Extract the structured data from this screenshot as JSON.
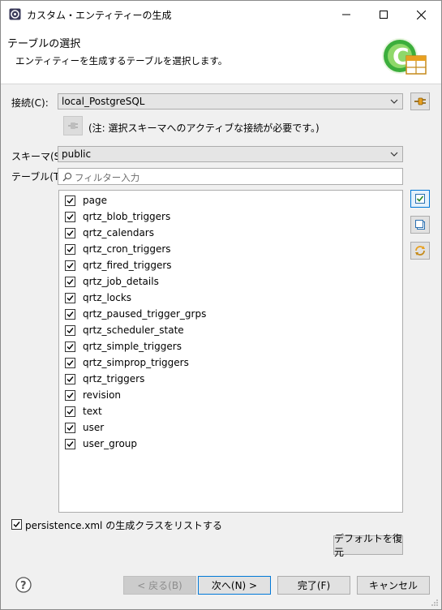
{
  "window": {
    "title": "カスタム・エンティティーの生成"
  },
  "banner": {
    "title": "テーブルの選択",
    "description": "エンティティーを生成するテーブルを選択します。"
  },
  "connection": {
    "label": "接続(C):",
    "value": "local_PostgreSQL",
    "note": "(注: 選択スキーマへのアクティブな接続が必要です。)"
  },
  "schema": {
    "label": "スキーマ(S):",
    "value": "public"
  },
  "tables": {
    "label": "テーブル(T):",
    "filter_placeholder": "フィルター入力",
    "items": [
      {
        "name": "page",
        "checked": true
      },
      {
        "name": "qrtz_blob_triggers",
        "checked": true
      },
      {
        "name": "qrtz_calendars",
        "checked": true
      },
      {
        "name": "qrtz_cron_triggers",
        "checked": true
      },
      {
        "name": "qrtz_fired_triggers",
        "checked": true
      },
      {
        "name": "qrtz_job_details",
        "checked": true
      },
      {
        "name": "qrtz_locks",
        "checked": true
      },
      {
        "name": "qrtz_paused_trigger_grps",
        "checked": true
      },
      {
        "name": "qrtz_scheduler_state",
        "checked": true
      },
      {
        "name": "qrtz_simple_triggers",
        "checked": true
      },
      {
        "name": "qrtz_simprop_triggers",
        "checked": true
      },
      {
        "name": "qrtz_triggers",
        "checked": true
      },
      {
        "name": "revision",
        "checked": true
      },
      {
        "name": "text",
        "checked": true
      },
      {
        "name": "user",
        "checked": true
      },
      {
        "name": "user_group",
        "checked": true
      }
    ]
  },
  "options": {
    "list_classes_label": "persistence.xml の生成クラスをリストする",
    "list_classes_checked": true
  },
  "buttons": {
    "restore_defaults": "デフォルトを復元",
    "back": "< 戻る(B)",
    "next": "次へ(N) >",
    "finish": "完了(F)",
    "cancel": "キャンセル"
  },
  "colors": {
    "accent": "#0078d7",
    "icon_green": "#3cae3c",
    "icon_orange": "#e8a020"
  }
}
